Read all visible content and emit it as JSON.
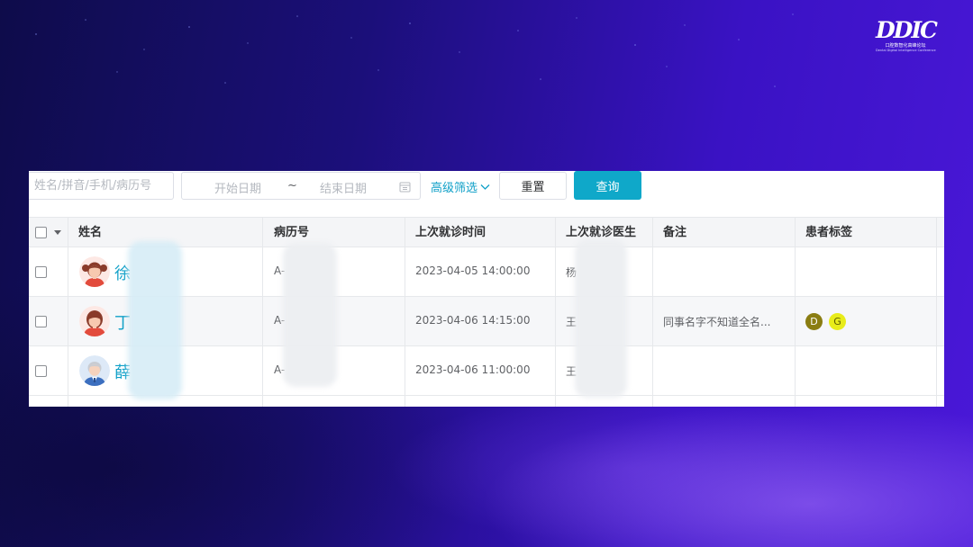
{
  "logo": {
    "mark": "DDIC",
    "subtitle": "口腔数智化高峰论坛",
    "subtitle_en": "Dental Digital Intelligence Conference"
  },
  "toolbar": {
    "search_placeholder": "姓名/拼音/手机/病历号",
    "date_start_placeholder": "开始日期",
    "date_separator": "~",
    "date_end_placeholder": "结束日期",
    "advanced_filter_label": "高级筛选",
    "reset_label": "重置",
    "query_label": "查询"
  },
  "table": {
    "headers": {
      "name": "姓名",
      "record_no": "病历号",
      "last_visit_time": "上次就诊时间",
      "last_doctor": "上次就诊医生",
      "remark": "备注",
      "tags": "患者标签"
    },
    "rows": [
      {
        "name": "徐",
        "record_no": "A-",
        "last_visit_time": "2023-04-05 14:00:00",
        "doctor": "杨",
        "remark": "",
        "avatar": "girl-avatar-icon",
        "tags": []
      },
      {
        "name": "丁",
        "record_no": "A-",
        "last_visit_time": "2023-04-06 14:15:00",
        "doctor": "王",
        "remark": "同事名字不知道全名...",
        "avatar": "woman-avatar-icon",
        "tags": [
          {
            "label": "D",
            "bg": "#8a7d12",
            "fg": "#ffffff"
          },
          {
            "label": "G",
            "bg": "#e8ec1a",
            "fg": "#5a5a00"
          }
        ]
      },
      {
        "name": "薛",
        "record_no": "A-",
        "last_visit_time": "2023-04-06 11:00:00",
        "doctor": "王",
        "remark": "",
        "avatar": "old-man-avatar-icon",
        "tags": []
      }
    ]
  },
  "colors": {
    "accent": "#10a0c8",
    "query_button": "#0fa8c9",
    "background_dark": "#0e0c4a",
    "background_light": "#4a18d8"
  }
}
